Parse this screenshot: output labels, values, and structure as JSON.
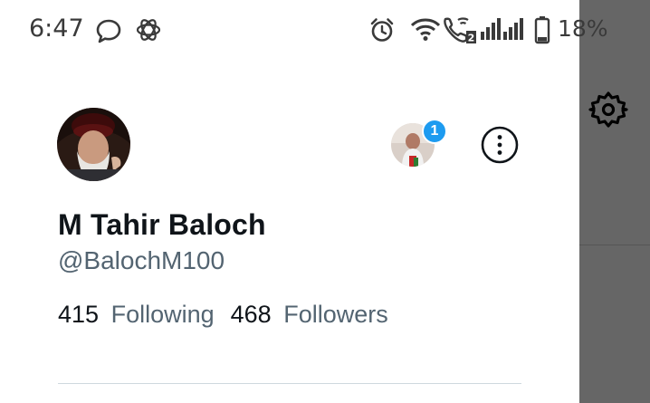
{
  "status_bar": {
    "time": "6:47",
    "battery_percent": "18%",
    "left_icons": [
      "chat-bubble-icon",
      "openai-logo-icon"
    ],
    "right_icons": [
      "alarm-icon",
      "wifi-icon",
      "wifi-call-icon",
      "signal-icon",
      "signal-icon",
      "battery-icon"
    ],
    "sim_label": "2"
  },
  "profile": {
    "name": "M Tahir Baloch",
    "handle": "@BalochM100",
    "following_count": "415",
    "following_label": "Following",
    "followers_count": "468",
    "followers_label": "Followers"
  },
  "account_switcher": {
    "badge_count": "1"
  },
  "colors": {
    "accent": "#1d9bf0",
    "primary_text": "#0f1419",
    "secondary_text": "#536471",
    "scrim": "#666666"
  }
}
